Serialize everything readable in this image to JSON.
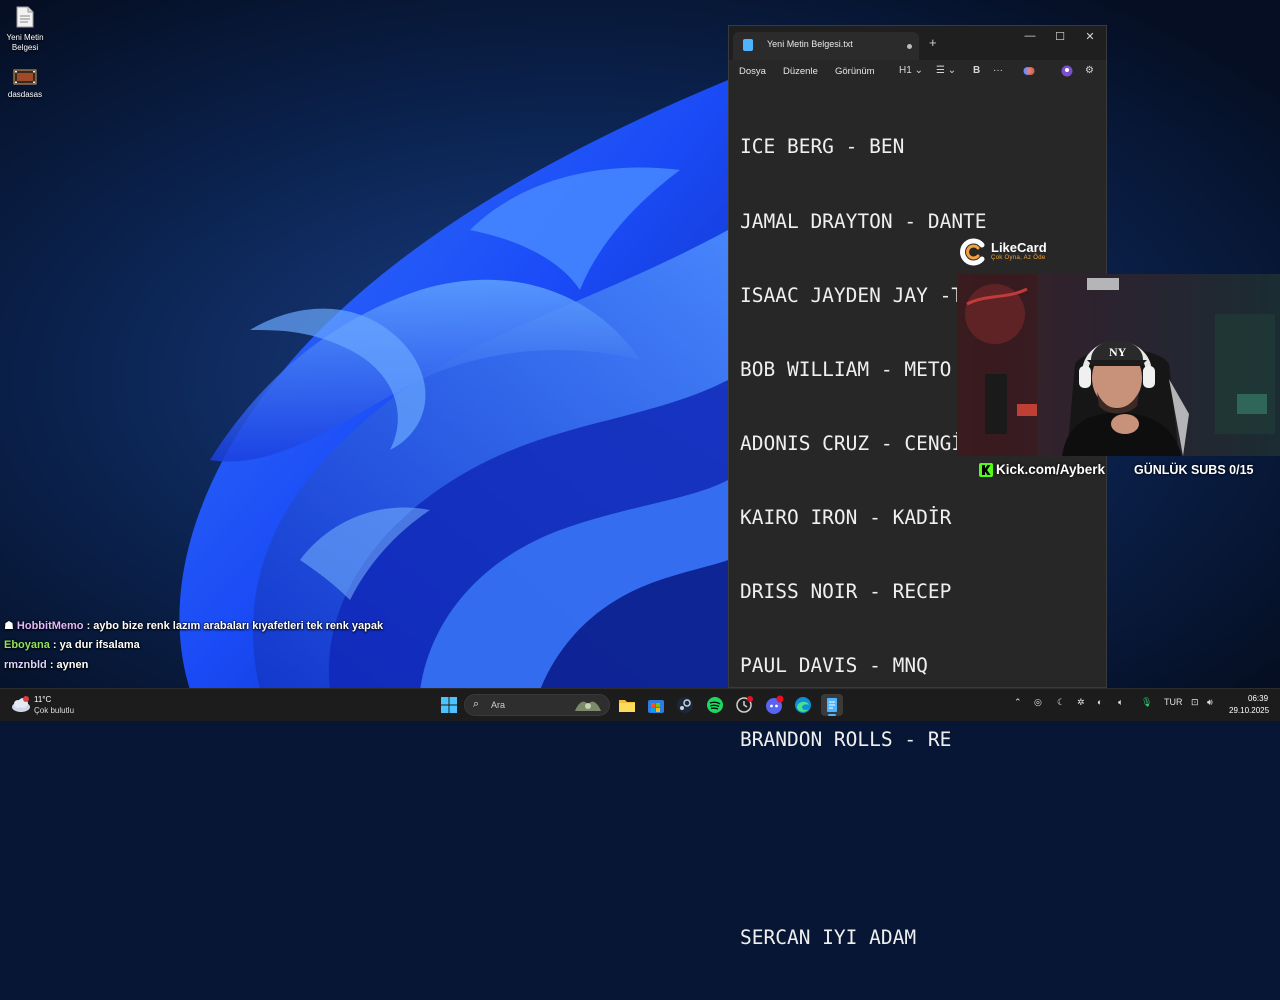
{
  "desktop": {
    "icons": [
      {
        "label": "Yeni Metin\nBelgesi",
        "icon": "text-document-icon"
      },
      {
        "label": "dasdasas",
        "icon": "video-file-icon"
      }
    ]
  },
  "notepad": {
    "tab_title": "Yeni Metin Belgesi.txt",
    "new_tab": "+",
    "window_controls": {
      "minimize": "—",
      "maximize": "☐",
      "close": "✕"
    },
    "menu": [
      "Dosya",
      "Düzenle",
      "Görünüm"
    ],
    "toolbar": {
      "heading": "H1",
      "list": "☰",
      "bold": "B",
      "more": "···"
    },
    "lines": [
      "ICE BERG - BEN",
      "JAMAL DRAYTON - DANTE",
      "ISAAC JAYDEN JAY -TALLSERCAN",
      "BOB WILLIAM - METO",
      "ADONIS CRUZ - CENGİZHAN",
      "KAIRO IRON - KADİR",
      "DRISS NOIR - RECEP",
      "PAUL DAVIS - MNQ",
      "BRANDON ROLLS - RE"
    ],
    "footer_line": "SERCAN IYI ADAM"
  },
  "overlay": {
    "likecard_title": "LikeCard",
    "likecard_sub": "Çok Oyna, Az Öde",
    "kick_url": "Kick.com/Ayberk",
    "subs": "GÜNLÜK SUBS 0/15"
  },
  "chat": [
    {
      "user": "HobbitMemo",
      "message": " : aybo bize renk lazım arabaları kıyafetleri tek renk yapak"
    },
    {
      "user": "Eboyana",
      "message": " : ya dur ifsalama"
    },
    {
      "user": "rmznbld",
      "message": " : aynen"
    }
  ],
  "taskbar": {
    "weather_temp": "11°C",
    "weather_desc": "Çok bulutlu",
    "search_placeholder": "Ara",
    "language": "TUR",
    "time": "06:39",
    "date": "29.10.2025",
    "colors": {
      "accent": "#0a84ff",
      "spotify": "#1ed760",
      "notepad": "#4fb4ff"
    }
  }
}
